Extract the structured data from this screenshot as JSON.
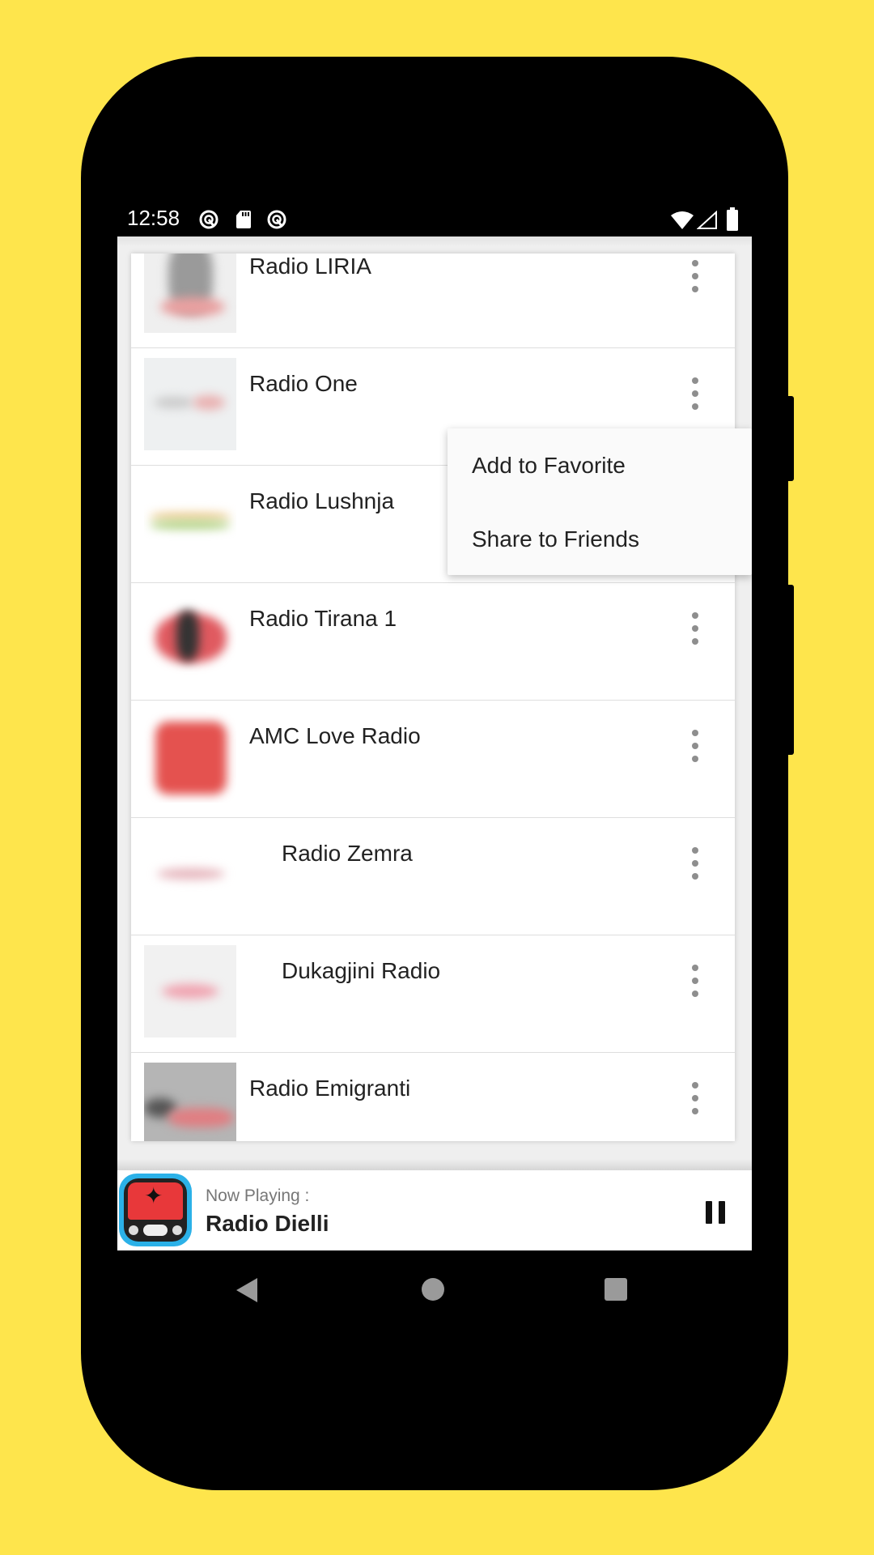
{
  "status_bar": {
    "time": "12:58",
    "left_icons": [
      "sync-icon",
      "sd-card-icon",
      "sync-icon"
    ],
    "right_icons": [
      "wifi-icon",
      "cellular-signal-icon",
      "battery-icon"
    ]
  },
  "stations": [
    {
      "name": "Radio LIRIA",
      "thumb": "liria"
    },
    {
      "name": "Radio One",
      "thumb": "one"
    },
    {
      "name": "Radio Lushnja",
      "thumb": "lushnja"
    },
    {
      "name": "Radio Tirana 1",
      "thumb": "tirana"
    },
    {
      "name": "AMC Love Radio",
      "thumb": "amc"
    },
    {
      "name": "Radio Zemra",
      "thumb": "zemra"
    },
    {
      "name": "Dukagjini Radio",
      "thumb": "dukagjini"
    },
    {
      "name": "Radio Emigranti",
      "thumb": "emigranti"
    }
  ],
  "context_menu": {
    "items": [
      "Add to Favorite",
      "Share to Friends"
    ]
  },
  "now_playing": {
    "label": "Now Playing :",
    "station": "Radio Dielli",
    "state_icon": "pause-icon"
  },
  "navigation": {
    "buttons": [
      "back",
      "home",
      "recents"
    ]
  },
  "colors": {
    "background": "#FEE54C",
    "app_icon_border": "#2BB1E8",
    "app_icon_red": "#E8383A"
  }
}
